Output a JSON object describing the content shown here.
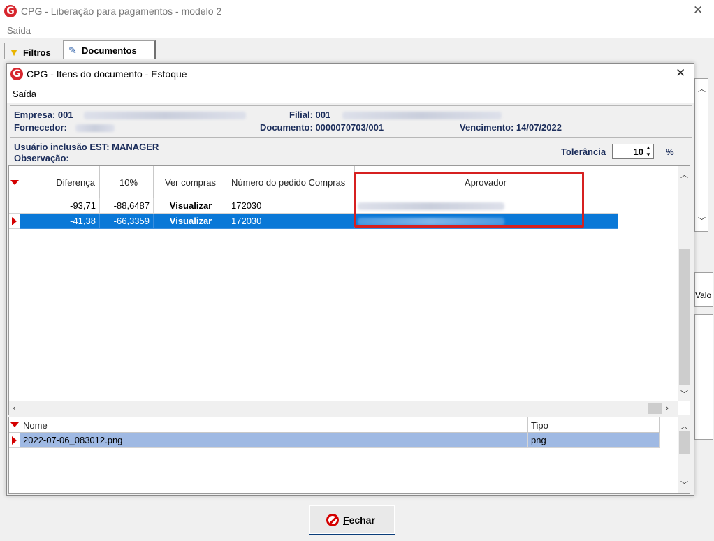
{
  "outer": {
    "title": "CPG - Liberação para pagamentos - modelo 2",
    "menu": "Saída",
    "tabs": [
      {
        "label": "Filtros",
        "icon": "filter-icon"
      },
      {
        "label": "Documentos",
        "icon": "document-edit-icon"
      }
    ],
    "partial_text": "Valo",
    "close_label": "Fechar"
  },
  "dialog": {
    "title": "CPG - Itens do documento - Estoque",
    "menu": "Saída",
    "info": {
      "empresa_label": "Empresa: 001",
      "fornecedor_label": "Fornecedor:",
      "filial_label": "Filial: 001",
      "documento": "Documento: 0000070703/001",
      "vencimento": "Vencimento: 14/07/2022",
      "usuario": "Usuário inclusão EST: MANAGER",
      "observacao": "Observação:",
      "tolerancia_label": "Tolerância",
      "tolerancia_value": "10",
      "percent": "%"
    },
    "grid": {
      "columns": [
        "Diferença",
        "10%",
        "Ver compras",
        "Número do pedido Compras",
        "Aprovador"
      ],
      "rows": [
        {
          "diferenca": "-93,71",
          "pct": "-88,6487",
          "ver": "Visualizar",
          "pedido": "172030",
          "selected": false
        },
        {
          "diferenca": "-41,38",
          "pct": "-66,3359",
          "ver": "Visualizar",
          "pedido": "172030",
          "selected": true
        }
      ]
    },
    "attachments": {
      "columns": [
        "Nome",
        "Tipo"
      ],
      "rows": [
        {
          "nome": "2022-07-06_083012.png",
          "tipo": "png"
        }
      ]
    }
  },
  "colors": {
    "selection": "#0a78d7",
    "highlight": "#d62020",
    "indicator": "#d40000",
    "label_text": "#1a2c5a"
  }
}
